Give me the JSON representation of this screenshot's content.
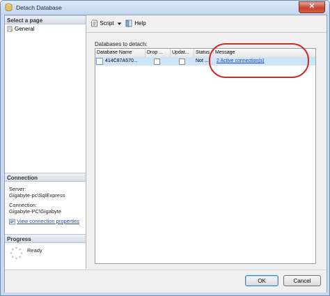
{
  "window": {
    "title": "Detach Database",
    "close_label": "✕"
  },
  "left_panel": {
    "select_page_header": "Select a page",
    "pages": [
      {
        "label": "General"
      }
    ],
    "connection_header": "Connection",
    "server_label": "Server:",
    "server_value": "Gigabyte-pc\\SqlExpress",
    "connection_label": "Connection:",
    "connection_value": "Gigabyte-PC\\Gigabyte",
    "view_properties_link": "View connection properties",
    "progress_header": "Progress",
    "progress_status": "Ready"
  },
  "toolbar": {
    "script_label": "Script",
    "help_label": "Help"
  },
  "main": {
    "databases_label": "Databases to detach:",
    "columns": [
      "Database Name",
      "Drop ...",
      "Updat...",
      "Status",
      "Message"
    ],
    "rows": [
      {
        "database_name": "414C87A570...",
        "drop_connections": false,
        "update_statistics": false,
        "status": "Not ...",
        "message": "2 Active connection(s)"
      }
    ]
  },
  "footer": {
    "ok_label": "OK",
    "cancel_label": "Cancel"
  },
  "colors": {
    "selection_row": "#cce3f8",
    "annotation_red": "#cf2a2a",
    "link_blue": "#1a3fbf",
    "close_button": "#c7432f"
  },
  "icons": [
    "database-icon",
    "close-icon",
    "page-icon",
    "connection-properties-icon",
    "script-icon",
    "dropdown-arrow-icon",
    "help-icon",
    "progress-spinner-icon"
  ]
}
